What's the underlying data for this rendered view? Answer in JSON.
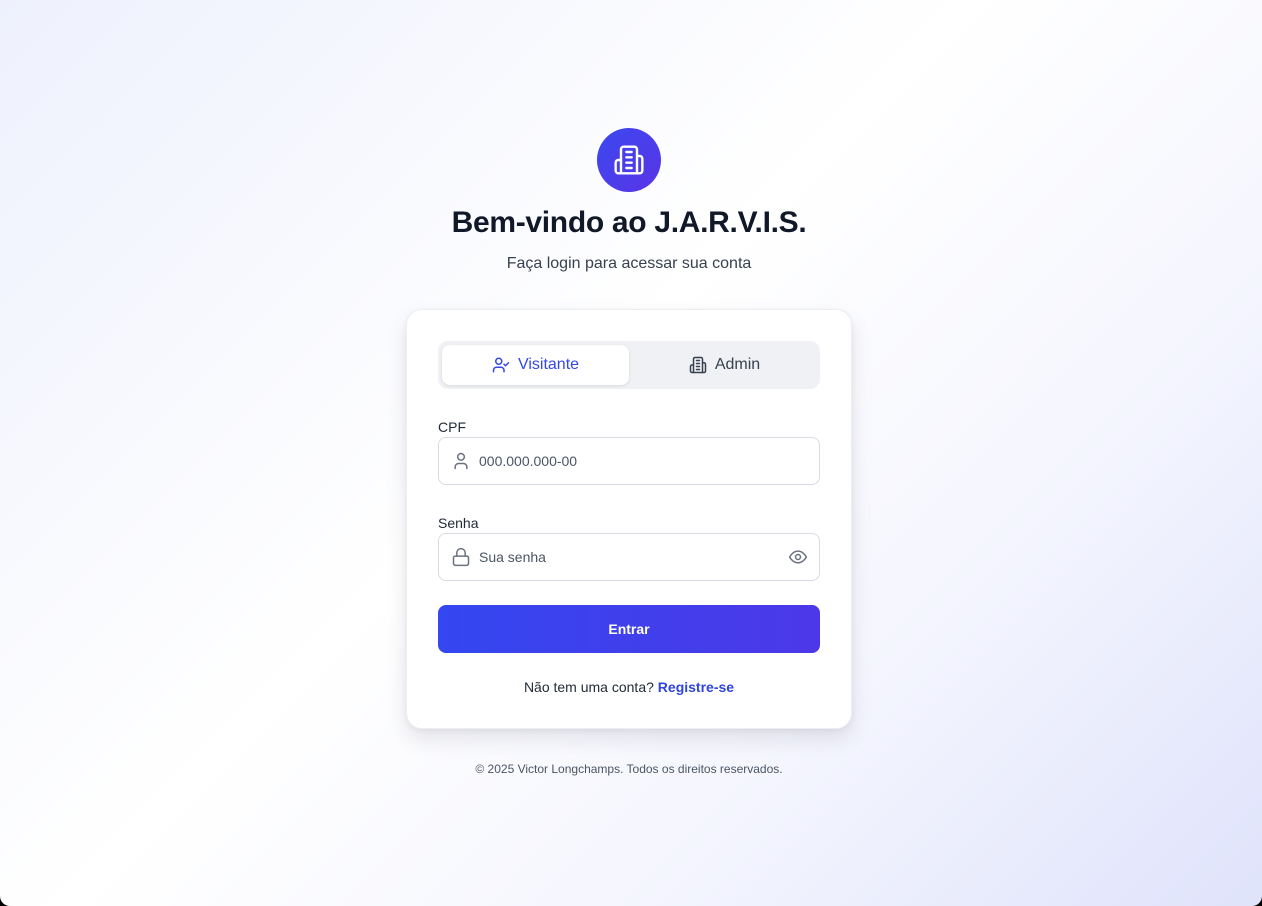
{
  "header": {
    "title": "Bem-vindo ao J.A.R.V.I.S.",
    "subtitle": "Faça login para acessar sua conta",
    "logo_icon": "building-icon"
  },
  "tabs": [
    {
      "label": "Visitante",
      "icon": "user-check-icon",
      "active": true
    },
    {
      "label": "Admin",
      "icon": "building-icon",
      "active": false
    }
  ],
  "form": {
    "cpf": {
      "label": "CPF",
      "placeholder": "000.000.000-00",
      "value": "",
      "icon": "user-icon"
    },
    "password": {
      "label": "Senha",
      "placeholder": "Sua senha",
      "value": "",
      "icon": "lock-icon",
      "toggle_icon": "eye-icon"
    },
    "submit_label": "Entrar"
  },
  "register": {
    "prompt": "Não tem uma conta?",
    "link": "Registre-se"
  },
  "footer": {
    "text": "© 2025 Victor Longchamps. Todos os direitos reservados."
  },
  "colors": {
    "accent": "#3347e6",
    "button_gradient_start": "#3447f0",
    "button_gradient_end": "#4c38e8"
  }
}
